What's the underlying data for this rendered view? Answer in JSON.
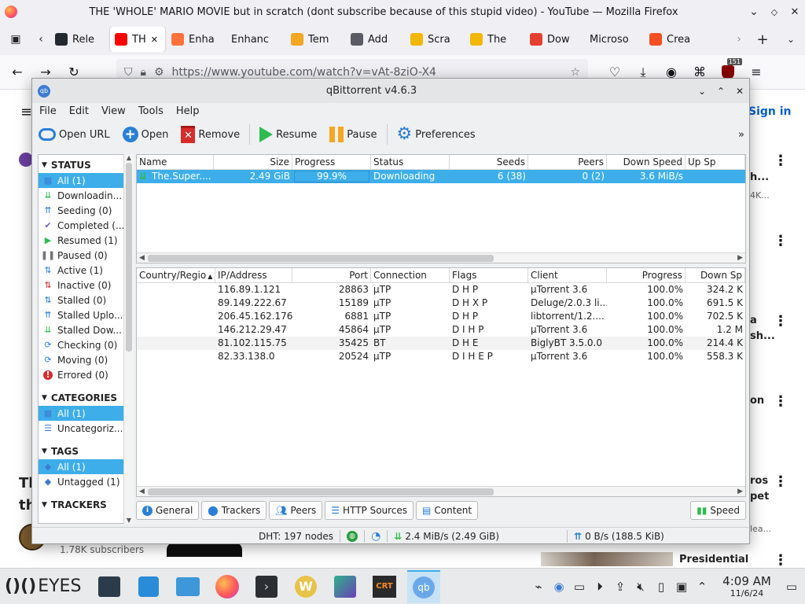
{
  "firefox": {
    "window_title": "THE 'WHOLE' MARIO MOVIE but in scratch (dont subscribe because of this stupid video) - YouTube — Mozilla Firefox",
    "tabs": [
      {
        "label": "Rele",
        "icon": "github-icon",
        "color": "#24292f"
      },
      {
        "label": "TH",
        "icon": "youtube-icon",
        "color": "#ff0000",
        "active": true
      },
      {
        "label": "Enha",
        "icon": "firefox-icon",
        "color": "#ff7139"
      },
      {
        "label": "Enhanc",
        "icon": "none",
        "color": "#f0f0f4"
      },
      {
        "label": "Tem",
        "icon": "mail-icon",
        "color": "#f5a623"
      },
      {
        "label": "Add",
        "icon": "puzzle-icon",
        "color": "#5b5b66"
      },
      {
        "label": "Scra",
        "icon": "coin-icon",
        "color": "#f2b705"
      },
      {
        "label": "The",
        "icon": "coin-icon",
        "color": "#f2b705"
      },
      {
        "label": "Dow",
        "icon": "x-icon",
        "color": "#e3402f"
      },
      {
        "label": "Microso",
        "icon": "none",
        "color": "#f0f0f4"
      },
      {
        "label": "Crea",
        "icon": "microsoft-icon",
        "color": "#f25022"
      }
    ],
    "url": "https://www.youtube.com/watch?v=vAt-8ziO-X4",
    "badge_count": "151"
  },
  "youtube": {
    "sign_in": "Sign in",
    "right_fragments": [
      "h...",
      "4K...",
      "a",
      "sh...",
      "on",
      "ros",
      "pet",
      "lea..."
    ],
    "left_fragments": [
      "Th",
      "th"
    ],
    "subscribers": "1.78K subscribers",
    "presidential": "Presidential"
  },
  "qbittorrent": {
    "title": "qBittorrent v4.6.3",
    "menu": [
      "File",
      "Edit",
      "View",
      "Tools",
      "Help"
    ],
    "toolbar": {
      "open_url": "Open URL",
      "open": "Open",
      "remove": "Remove",
      "resume": "Resume",
      "pause": "Pause",
      "preferences": "Preferences",
      "more": "»"
    },
    "sidebar": {
      "status_header": "STATUS",
      "status_items": [
        {
          "label": "All (1)",
          "icon": "all",
          "selected": true
        },
        {
          "label": "Downloadin...",
          "icon": "download"
        },
        {
          "label": "Seeding (0)",
          "icon": "upload"
        },
        {
          "label": "Completed (...",
          "icon": "check"
        },
        {
          "label": "Resumed (1)",
          "icon": "play"
        },
        {
          "label": "Paused (0)",
          "icon": "pause"
        },
        {
          "label": "Active (1)",
          "icon": "active"
        },
        {
          "label": "Inactive (0)",
          "icon": "inactive"
        },
        {
          "label": "Stalled (0)",
          "icon": "stalled"
        },
        {
          "label": "Stalled Uplo...",
          "icon": "stalled-up"
        },
        {
          "label": "Stalled Dow...",
          "icon": "stalled-down"
        },
        {
          "label": "Checking (0)",
          "icon": "checking"
        },
        {
          "label": "Moving (0)",
          "icon": "moving"
        },
        {
          "label": "Errored (0)",
          "icon": "error"
        }
      ],
      "categories_header": "CATEGORIES",
      "categories": [
        {
          "label": "All (1)",
          "selected": true
        },
        {
          "label": "Uncategoriz...",
          "selected": false
        }
      ],
      "tags_header": "TAGS",
      "tags": [
        {
          "label": "All (1)",
          "selected": true
        },
        {
          "label": "Untagged (1)",
          "selected": false
        }
      ],
      "trackers_header": "TRACKERS"
    },
    "torrent_columns": [
      "Name",
      "Size",
      "Progress",
      "Status",
      "Seeds",
      "Peers",
      "Down Speed",
      "Up Sp"
    ],
    "torrents": [
      {
        "name": "The.Super....",
        "size": "2.49 GiB",
        "progress": "99.9%",
        "progress_fraction": 0.999,
        "status": "Downloading",
        "seeds": "6 (38)",
        "peers": "0 (2)",
        "down_speed": "3.6 MiB/s",
        "up_speed": ""
      }
    ],
    "peer_columns": [
      "Country/Regio",
      "IP/Address",
      "Port",
      "Connection",
      "Flags",
      "Client",
      "Progress",
      "Down Sp"
    ],
    "peers": [
      {
        "ip": "116.89.1.121",
        "port": "28863",
        "connection": "μTP",
        "flags": "D H P",
        "client": "μTorrent 3.6",
        "progress": "100.0%",
        "down": "324.2 K"
      },
      {
        "ip": "89.149.222.67",
        "port": "15189",
        "connection": "μTP",
        "flags": "D H X P",
        "client": "Deluge/2.0.3 li...",
        "progress": "100.0%",
        "down": "691.5 K"
      },
      {
        "ip": "206.45.162.176",
        "port": "6881",
        "connection": "μTP",
        "flags": "D H P",
        "client": "libtorrent/1.2....",
        "progress": "100.0%",
        "down": "702.5 K"
      },
      {
        "ip": "146.212.29.47",
        "port": "45864",
        "connection": "μTP",
        "flags": "D I H P",
        "client": "μTorrent 3.6",
        "progress": "100.0%",
        "down": "1.2 M"
      },
      {
        "ip": "81.102.115.75",
        "port": "35425",
        "connection": "BT",
        "flags": "D H E",
        "client": "BiglyBT 3.5.0.0",
        "progress": "100.0%",
        "down": "214.4 K"
      },
      {
        "ip": "82.33.138.0",
        "port": "20524",
        "connection": "μTP",
        "flags": "D I H E P",
        "client": "μTorrent 3.6",
        "progress": "100.0%",
        "down": "558.3 K"
      }
    ],
    "property_tabs": [
      "General",
      "Trackers",
      "Peers",
      "HTTP Sources",
      "Content"
    ],
    "speed_button": "Speed",
    "status_bar": {
      "dht": "DHT: 197 nodes",
      "download": "2.4 MiB/s (2.49 GiB)",
      "upload": "0 B/s (188.5 KiB)"
    }
  },
  "taskbar": {
    "eyes_label": "EYES",
    "time": "4:09 AM",
    "date": "11/6/24"
  }
}
